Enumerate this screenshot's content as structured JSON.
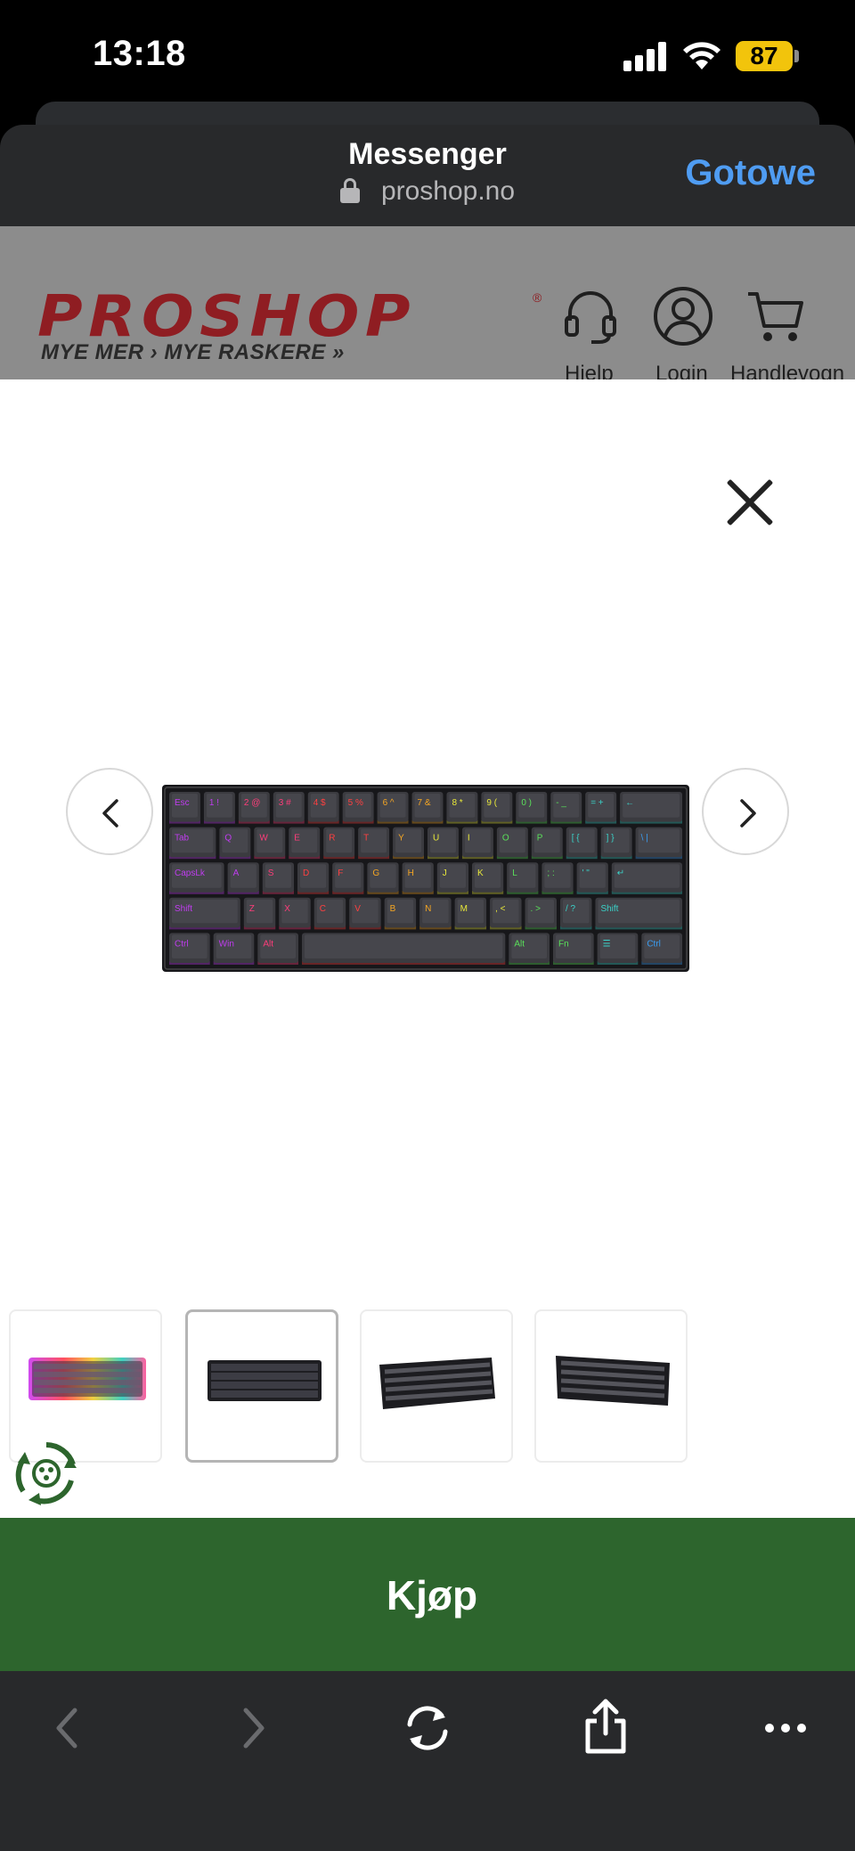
{
  "status_bar": {
    "time": "13:18",
    "battery": "87"
  },
  "browser": {
    "title": "Messenger",
    "url": "proshop.no",
    "done_label": "Gotowe"
  },
  "site": {
    "logo_text": "PROSHOP",
    "logo_reg": "®",
    "tagline": "MYE MER › MYE RASKERE »",
    "header_links": [
      {
        "label": "Hjelp",
        "icon": "headset-icon"
      },
      {
        "label": "Login",
        "icon": "user-icon"
      },
      {
        "label": "Handlevogn",
        "icon": "cart-icon"
      }
    ]
  },
  "lightbox": {
    "thumbnails": [
      {
        "name": "rgb-keyboard-top"
      },
      {
        "name": "keyboard-top-dark"
      },
      {
        "name": "keyboard-angle-left"
      },
      {
        "name": "keyboard-angle-right"
      }
    ],
    "active_thumbnail": 1,
    "keyboard_rows": [
      [
        "Esc",
        "1 !",
        "2 @",
        "3 #",
        "4 $",
        "5 %",
        "6 ^",
        "7 &",
        "8 *",
        "9 (",
        "0 )",
        "- _",
        "= +",
        "←"
      ],
      [
        "Tab",
        "Q",
        "W",
        "E",
        "R",
        "T",
        "Y",
        "U",
        "I",
        "O",
        "P",
        "[ {",
        "] }",
        "\\ |"
      ],
      [
        "CapsLk",
        "A",
        "S",
        "D",
        "F",
        "G",
        "H",
        "J",
        "K",
        "L",
        "; :",
        "' \"",
        "↵"
      ],
      [
        "Shift",
        "Z",
        "X",
        "C",
        "V",
        "B",
        "N",
        "M",
        ", <",
        ". >",
        "/ ?",
        "Shift"
      ],
      [
        "Ctrl",
        "Win",
        "Alt",
        "",
        "Alt",
        "Fn",
        "☰",
        "Ctrl"
      ]
    ],
    "colors": {
      "accent_rgb": [
        "#c03cf0",
        "#ff3d7a",
        "#ff4040",
        "#f5a623",
        "#e8e83a",
        "#5ae05a",
        "#3ad2c8",
        "#3a9cf0"
      ]
    }
  },
  "buy": {
    "label": "Kjøp",
    "color": "#2d652d"
  },
  "toolbar": {
    "items": [
      "back-icon",
      "forward-icon",
      "reload-icon",
      "share-icon",
      "more-icon"
    ]
  }
}
